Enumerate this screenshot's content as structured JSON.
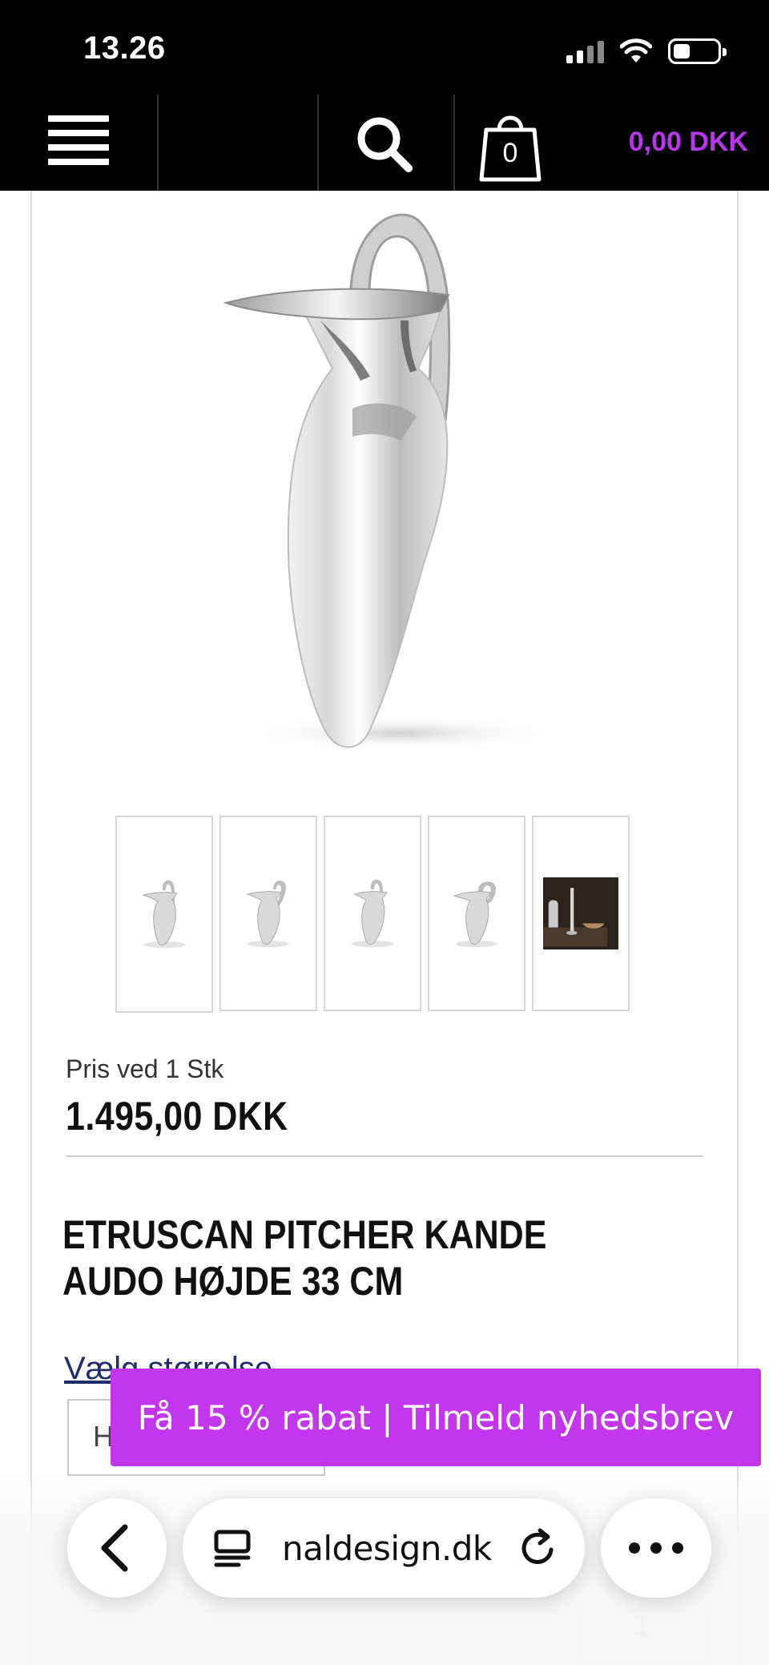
{
  "status_bar": {
    "time": "13.26"
  },
  "header": {
    "cart_count": "0",
    "cart_total": "0,00 DKK",
    "colors": {
      "background": "#000000",
      "accent": "#b935ee"
    }
  },
  "product": {
    "price_label": "Pris ved  1 Stk",
    "price": "1.495,00 DKK",
    "title": "ETRUSCAN PITCHER KANDE AUDO HØJDE 33 CM",
    "size_label": "Vælg størrelse",
    "size_value": "H",
    "quantity": "1",
    "thumbnails": [
      "pitcher-thumb",
      "pitcher-thumb",
      "pitcher-thumb",
      "pitcher-thumb",
      "pitcher-lifestyle-thumb"
    ]
  },
  "newsletter": {
    "text": "Få 15 % rabat | Tilmeld nyhedsbrev",
    "color": "#c237ee"
  },
  "browser": {
    "url": "naldesign.dk"
  }
}
